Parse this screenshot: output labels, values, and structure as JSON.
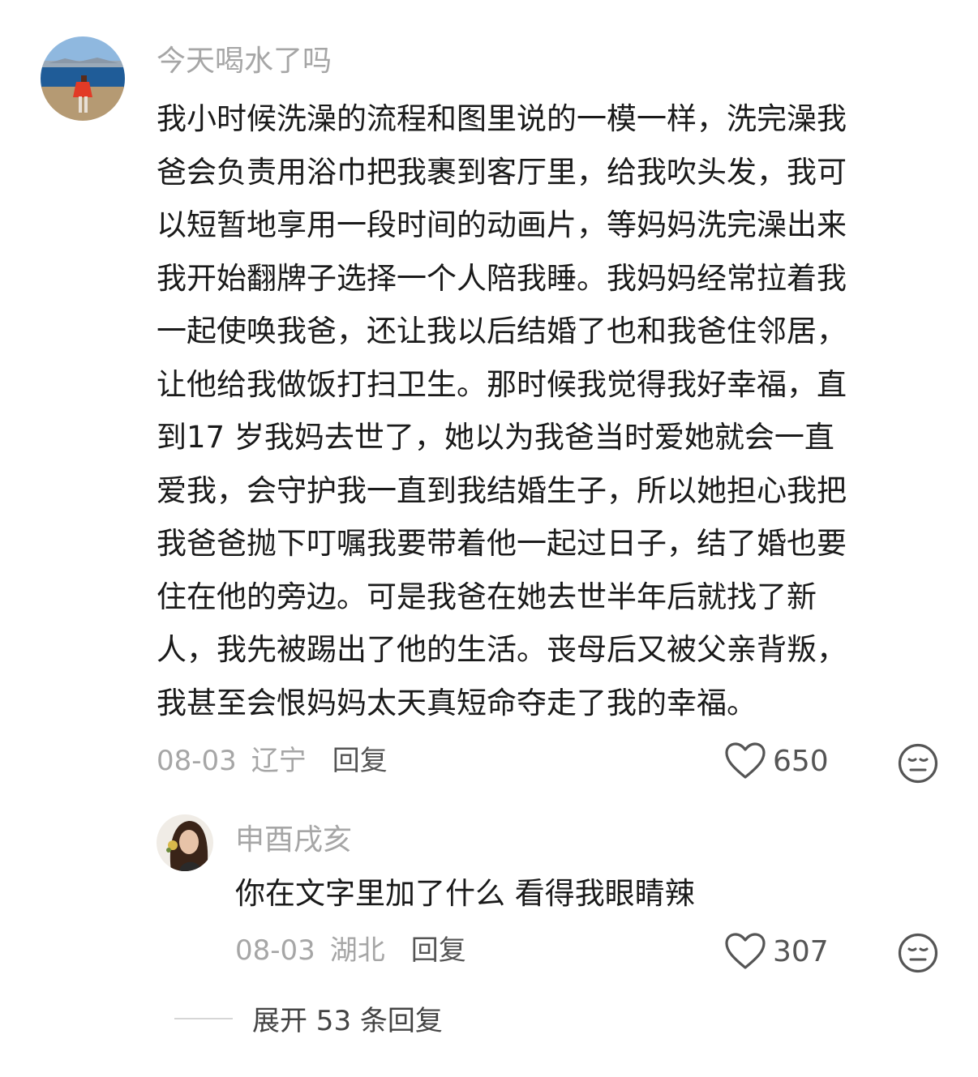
{
  "comment": {
    "username": "今天喝水了吗",
    "lines": [
      "我小时候洗澡的流程和图里说的一模一样，洗完澡我",
      "爸会负责用浴巾把我裹到客厅里，给我吹头发，我可",
      "以短暂地享用一段时间的动画片，等妈妈洗完澡出来",
      "我开始翻牌子选择一个人陪我睡。我妈妈经常拉着我",
      "一起使唤我爸，还让我以后结婚了也和我爸住邻居，",
      "让他给我做饭打扫卫生。那时候我觉得我好幸福，直",
      "到17 岁我妈去世了，她以为我爸当时爱她就会一直",
      "爱我，会守护我一直到我结婚生子，所以她担心我把",
      "我爸爸抛下叮嘱我要带着他一起过日子，结了婚也要",
      "住在他的旁边。可是我爸在她去世半年后就找了新",
      "人，我先被踢出了他的生活。丧母后又被父亲背叛，",
      "我甚至会恨妈妈太天真短命夺走了我的幸福。"
    ],
    "date": "08-03",
    "location": "辽宁",
    "reply_label": "回复",
    "like_count": "650",
    "icons": {
      "like": "heart-outline-icon",
      "reaction": "meh-face-icon"
    }
  },
  "reply": {
    "username": "申酉戌亥",
    "text": "你在文字里加了什么 看得我眼睛辣",
    "date": "08-03",
    "location": "湖北",
    "reply_label": "回复",
    "like_count": "307"
  },
  "expand": {
    "label": "展开 53 条回复"
  },
  "colors": {
    "text": "#1a1a1a",
    "muted": "#a6a6a6",
    "action": "#555555"
  }
}
